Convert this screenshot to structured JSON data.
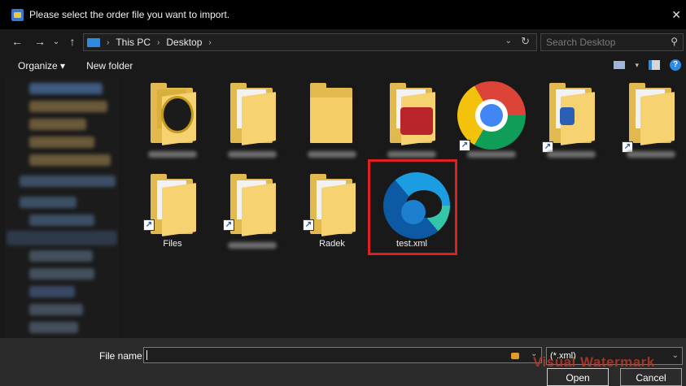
{
  "window": {
    "title": "Please select the order file you want to import.",
    "close_glyph": "✕"
  },
  "nav": {
    "back_glyph": "←",
    "forward_glyph": "→",
    "recent_glyph": "⌄",
    "up_glyph": "↑",
    "breadcrumbs": [
      "This PC",
      "Desktop"
    ],
    "crumb_separator": "›",
    "dropdown_glyph": "⌄",
    "refresh_glyph": "↻",
    "search_placeholder": "Search Desktop",
    "search_glyph": "⚲"
  },
  "toolbar": {
    "organize_label": "Organize ▾",
    "new_folder_label": "New folder",
    "view_caret": "▾",
    "help_glyph": "?"
  },
  "files": [
    {
      "label": "",
      "kind": "folder",
      "shortcut": false
    },
    {
      "label": "",
      "kind": "folder",
      "shortcut": false
    },
    {
      "label": "",
      "kind": "folder",
      "shortcut": false
    },
    {
      "label": "",
      "kind": "folder",
      "shortcut": false
    },
    {
      "label": "",
      "kind": "chrome-shortcut",
      "shortcut": true
    },
    {
      "label": "",
      "kind": "folder",
      "shortcut": true
    },
    {
      "label": "",
      "kind": "folder",
      "shortcut": true
    },
    {
      "label": "Files",
      "kind": "folder",
      "shortcut": true
    },
    {
      "label": "",
      "kind": "folder",
      "shortcut": true
    },
    {
      "label": "Radek",
      "kind": "folder",
      "shortcut": true
    },
    {
      "label": "test.xml",
      "kind": "edge-file",
      "shortcut": false,
      "selected": true
    }
  ],
  "shortcut_glyph": "↗",
  "footer": {
    "file_name_label": "File name:",
    "file_name_value": "",
    "file_type_value": "(*.xml)",
    "dropdown_glyph": "⌄",
    "open_label": "Open",
    "cancel_label": "Cancel",
    "watermark": "Visual Watermark"
  },
  "colors": {
    "highlight": "#e0201f",
    "folder": "#e2b94f",
    "accent": "#2f8be0"
  }
}
